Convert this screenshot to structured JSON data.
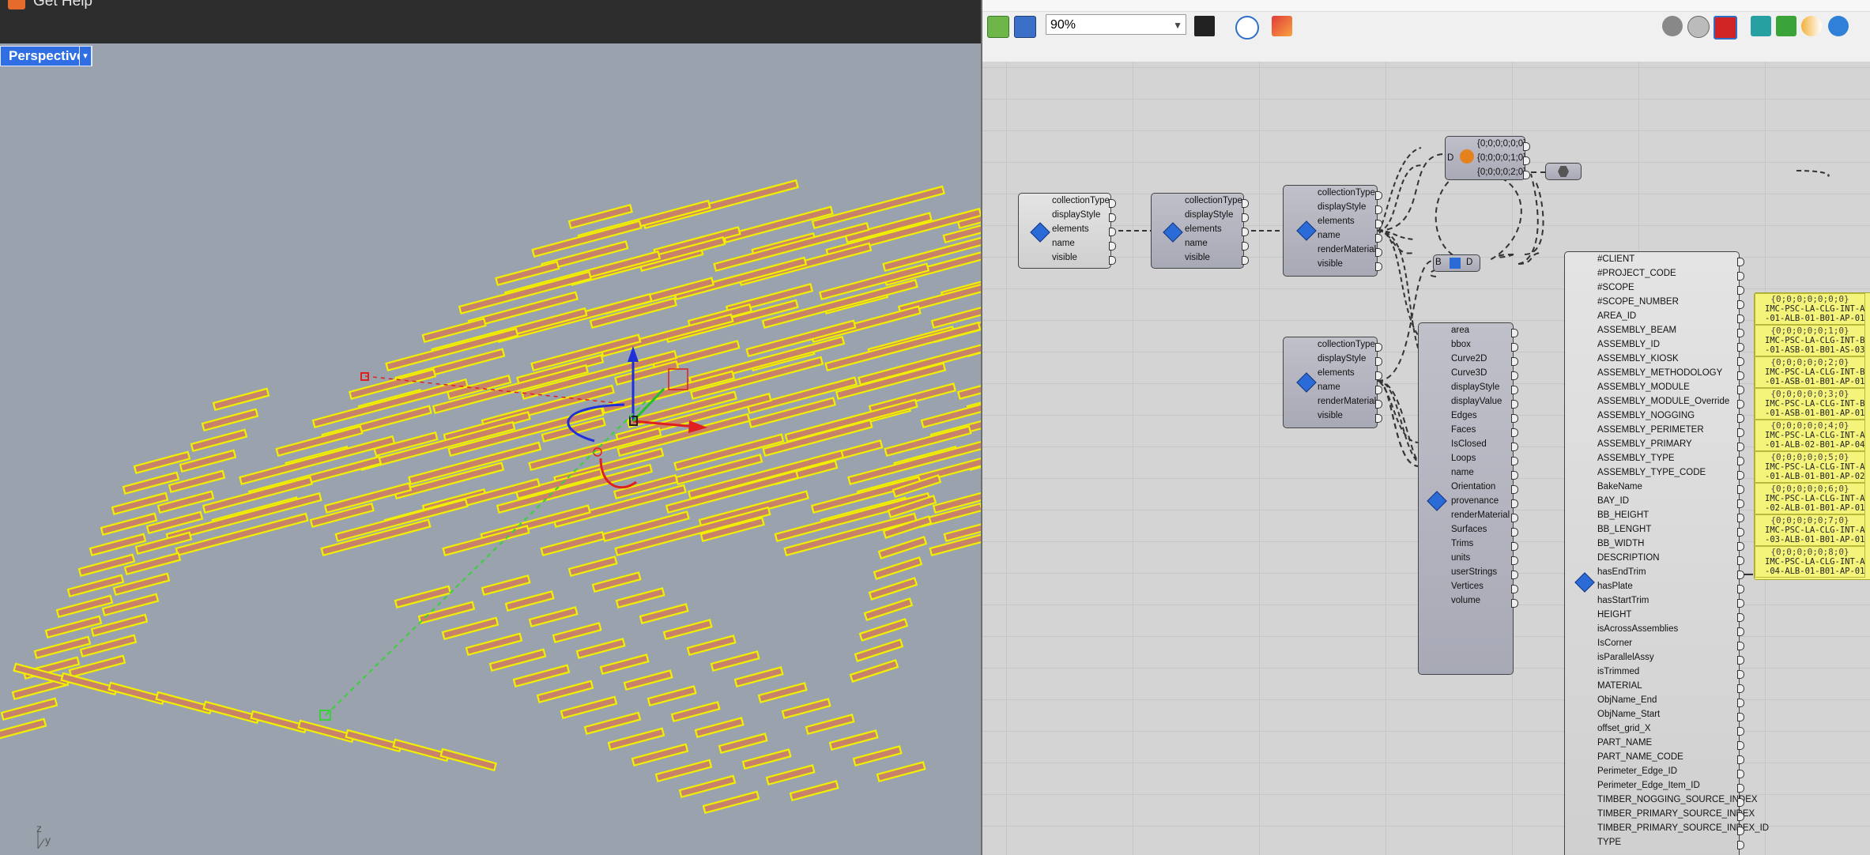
{
  "header": {
    "help_label": "Get Help"
  },
  "viewport": {
    "name": "Perspective",
    "dropdown_glyph": "▾",
    "axis_z": "z",
    "axis_y": "y",
    "element_color": "#c9826a",
    "outline_color": "#f0f000"
  },
  "grasshopper": {
    "zoom": "90%",
    "toolbar_icons": [
      "open-file-icon",
      "save-file-icon",
      "zoom-select",
      "sketch-icon",
      "preview-eye-icon",
      "paint-brush-icon",
      "preview-shaded-icon",
      "preview-wire-icon",
      "preview-selected-icon",
      "bake-icon",
      "bake-hidden-icon",
      "gradient-icon",
      "sphere-icon"
    ],
    "comp1_inputs": [
      "collectionType",
      "displayStyle",
      "elements",
      "name",
      "visible"
    ],
    "comp2_inputs": [
      "collectionType",
      "displayStyle",
      "elements",
      "name",
      "visible"
    ],
    "comp3_outputs": [
      "collectionType",
      "displayStyle",
      "elements",
      "name",
      "renderMaterial",
      "visible"
    ],
    "comp4_outputs": [
      "collectionType",
      "displayStyle",
      "elements",
      "name",
      "renderMaterial",
      "visible"
    ],
    "tree_values": [
      "{0;0;0;0;0;0}",
      "{0;0;0;0;1;0}",
      "{0;0;0;0;2;0}"
    ],
    "tree_in": "D",
    "bd_labels": [
      "B",
      "D"
    ],
    "props": [
      "area",
      "bbox",
      "Curve2D",
      "Curve3D",
      "displayStyle",
      "displayValue",
      "Edges",
      "Faces",
      "IsClosed",
      "Loops",
      "name",
      "Orientation",
      "provenance",
      "renderMaterial",
      "Surfaces",
      "Trims",
      "units",
      "userStrings",
      "Vertices",
      "volume"
    ],
    "userstring_keys": [
      "#CLIENT",
      "#PROJECT_CODE",
      "#SCOPE",
      "#SCOPE_NUMBER",
      "AREA_ID",
      "ASSEMBLY_BEAM",
      "ASSEMBLY_ID",
      "ASSEMBLY_KIOSK",
      "ASSEMBLY_METHODOLOGY",
      "ASSEMBLY_MODULE",
      "ASSEMBLY_MODULE_Override",
      "ASSEMBLY_NOGGING",
      "ASSEMBLY_PERIMETER",
      "ASSEMBLY_PRIMARY",
      "ASSEMBLY_TYPE",
      "ASSEMBLY_TYPE_CODE",
      "BakeName",
      "BAY_ID",
      "BB_HEIGHT",
      "BB_LENGHT",
      "BB_WIDTH",
      "DESCRIPTION",
      "hasEndTrim",
      "hasPlate",
      "hasStartTrim",
      "HEIGHT",
      "isAcrossAssemblies",
      "IsCorner",
      "isParallelAssy",
      "isTrimmed",
      "MATERIAL",
      "ObjName_End",
      "ObjName_Start",
      "offset_grid_X",
      "PART_NAME",
      "PART_NAME_CODE",
      "Perimeter_Edge_ID",
      "Perimeter_Edge_Item_ID",
      "TIMBER_NOGGING_SOURCE_INDEX",
      "TIMBER_PRIMARY_SOURCE_INDEX",
      "TIMBER_PRIMARY_SOURCE_INDEX_ID",
      "TYPE"
    ],
    "panel_rows": [
      {
        "path": "{0;0;0;0;0;0;0}",
        "l1": "IMC-PSC-LA-CLG-INT-A",
        "l2": "-01-ALB-01-B01-AP-01"
      },
      {
        "path": "{0;0;0;0;0;1;0}",
        "l1": "IMC-PSC-LA-CLG-INT-B",
        "l2": "-01-ASB-01-B01-AS-03"
      },
      {
        "path": "{0;0;0;0;0;2;0}",
        "l1": "IMC-PSC-LA-CLG-INT-B",
        "l2": "-01-ASB-01-B01-AP-01"
      },
      {
        "path": "{0;0;0;0;0;3;0}",
        "l1": "IMC-PSC-LA-CLG-INT-B",
        "l2": "-01-ASB-01-B01-AP-01"
      },
      {
        "path": "{0;0;0;0;0;4;0}",
        "l1": "IMC-PSC-LA-CLG-INT-A",
        "l2": "-01-ALB-02-B01-AP-04"
      },
      {
        "path": "{0;0;0;0;0;5;0}",
        "l1": "IMC-PSC-LA-CLG-INT-A",
        "l2": "-01-ALB-01-B01-AP-02"
      },
      {
        "path": "{0;0;0;0;0;6;0}",
        "l1": "IMC-PSC-LA-CLG-INT-A",
        "l2": "-02-ALB-01-B01-AP-01"
      },
      {
        "path": "{0;0;0;0;0;7;0}",
        "l1": "IMC-PSC-LA-CLG-INT-A",
        "l2": "-03-ALB-01-B01-AP-01"
      },
      {
        "path": "{0;0;0;0;0;8;0}",
        "l1": "IMC-PSC-LA-CLG-INT-A",
        "l2": "-04-ALB-01-B01-AP-01"
      }
    ]
  }
}
